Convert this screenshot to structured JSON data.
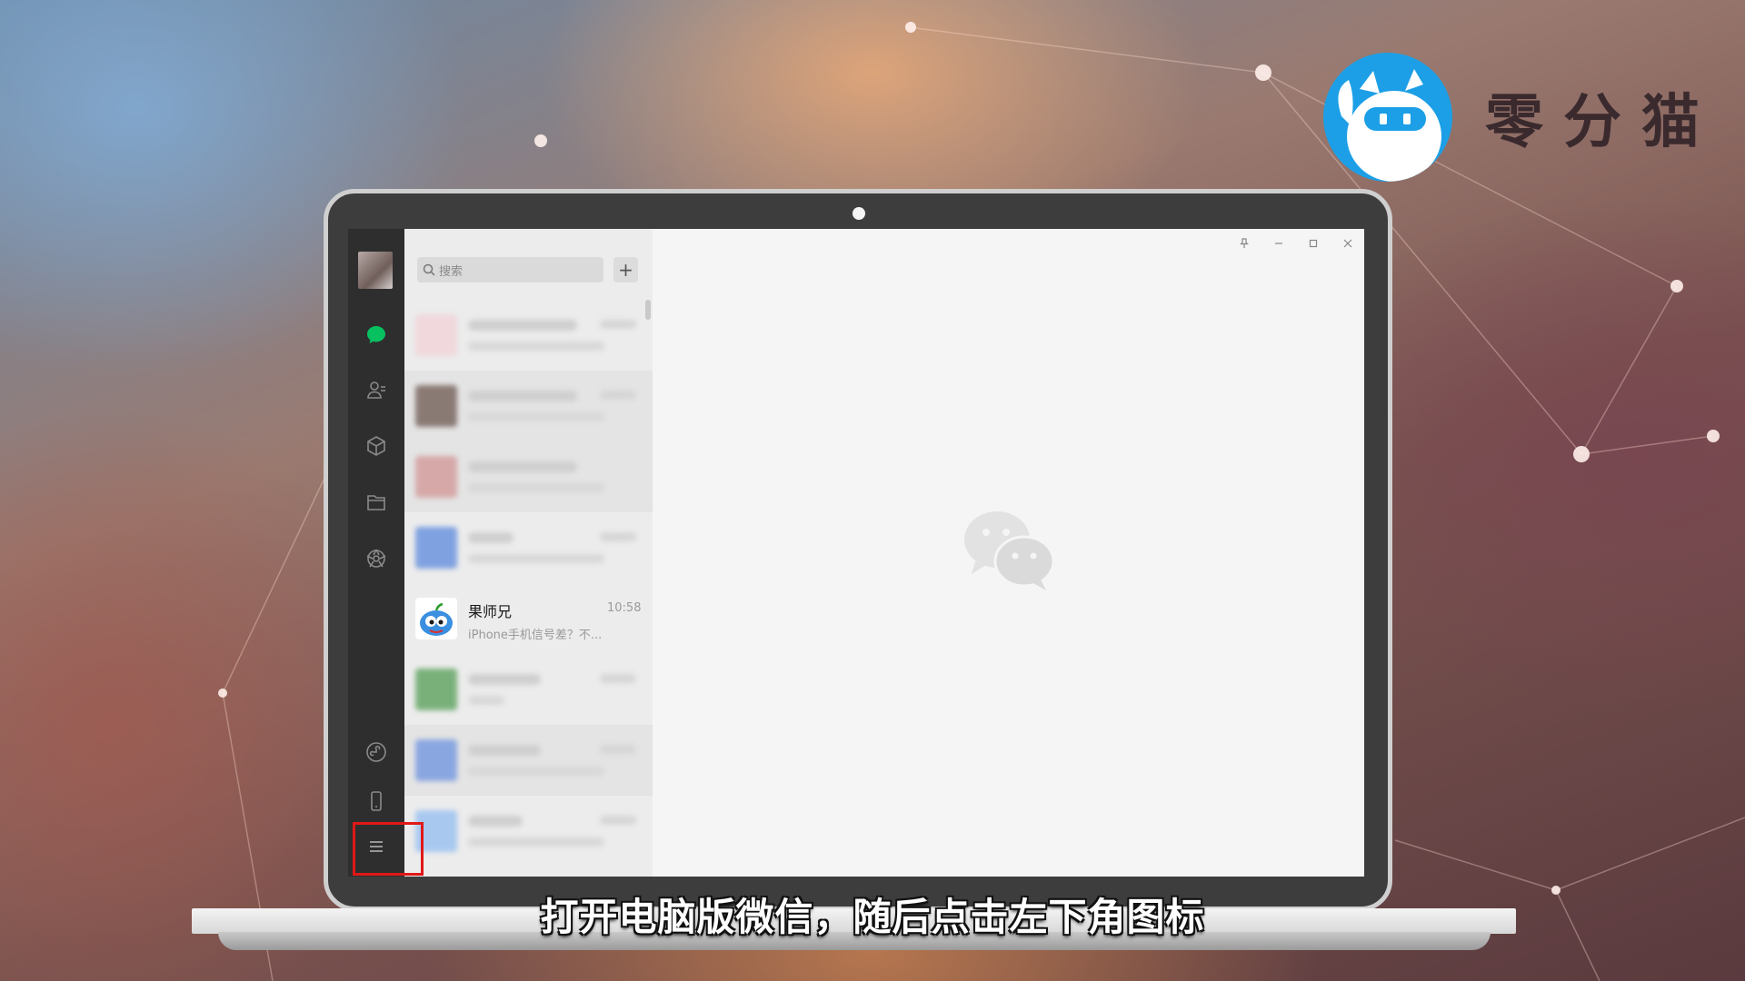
{
  "brand": {
    "name": "零分猫",
    "accent": "#1c9fe6"
  },
  "subtitle": "打开电脑版微信，随后点击左下角图标",
  "wechat": {
    "sidebar": {
      "icons": [
        "chat-icon",
        "contacts-icon",
        "favorites-icon",
        "files-icon",
        "moments-icon",
        "mini-program-icon",
        "phone-icon",
        "menu-icon"
      ],
      "active_color": "#07c160"
    },
    "search": {
      "placeholder": "搜索",
      "add_label": "+"
    },
    "chats": [
      {
        "name": "果师兄",
        "time": "10:58",
        "preview": "iPhone手机信号差？不..."
      }
    ],
    "window_controls": [
      "pin-icon",
      "minimize-icon",
      "maximize-icon",
      "close-icon"
    ]
  }
}
